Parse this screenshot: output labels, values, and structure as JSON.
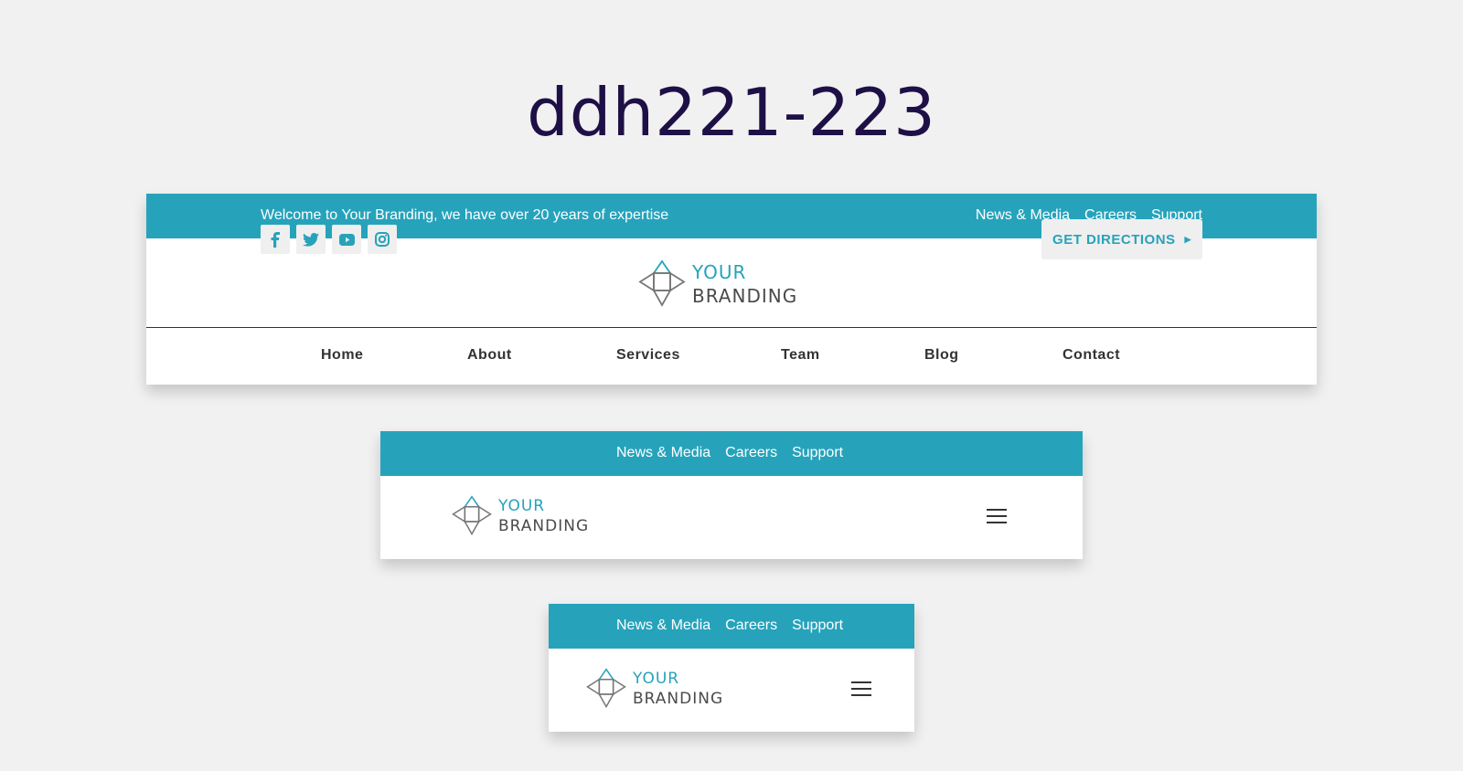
{
  "page": {
    "title": "ddh221-223"
  },
  "brand": {
    "line1": "YOUR",
    "line2": "BRANDING",
    "accent": "#26a3bb"
  },
  "desktop": {
    "welcome": "Welcome to Your Branding, we have over 20 years of expertise",
    "top_links": [
      "News & Media",
      "Careers",
      "Support"
    ],
    "social_icons": [
      "facebook-icon",
      "twitter-icon",
      "youtube-icon",
      "instagram-icon"
    ],
    "cta": {
      "label": "GET DIRECTIONS",
      "icon": "caret-right-icon"
    },
    "nav": [
      "Home",
      "About",
      "Services",
      "Team",
      "Blog",
      "Contact"
    ]
  },
  "tablet": {
    "top_links": [
      "News & Media",
      "Careers",
      "Support"
    ],
    "menu_icon": "hamburger-icon"
  },
  "mobile": {
    "top_links": [
      "News & Media",
      "Careers",
      "Support"
    ],
    "menu_icon": "hamburger-icon"
  }
}
